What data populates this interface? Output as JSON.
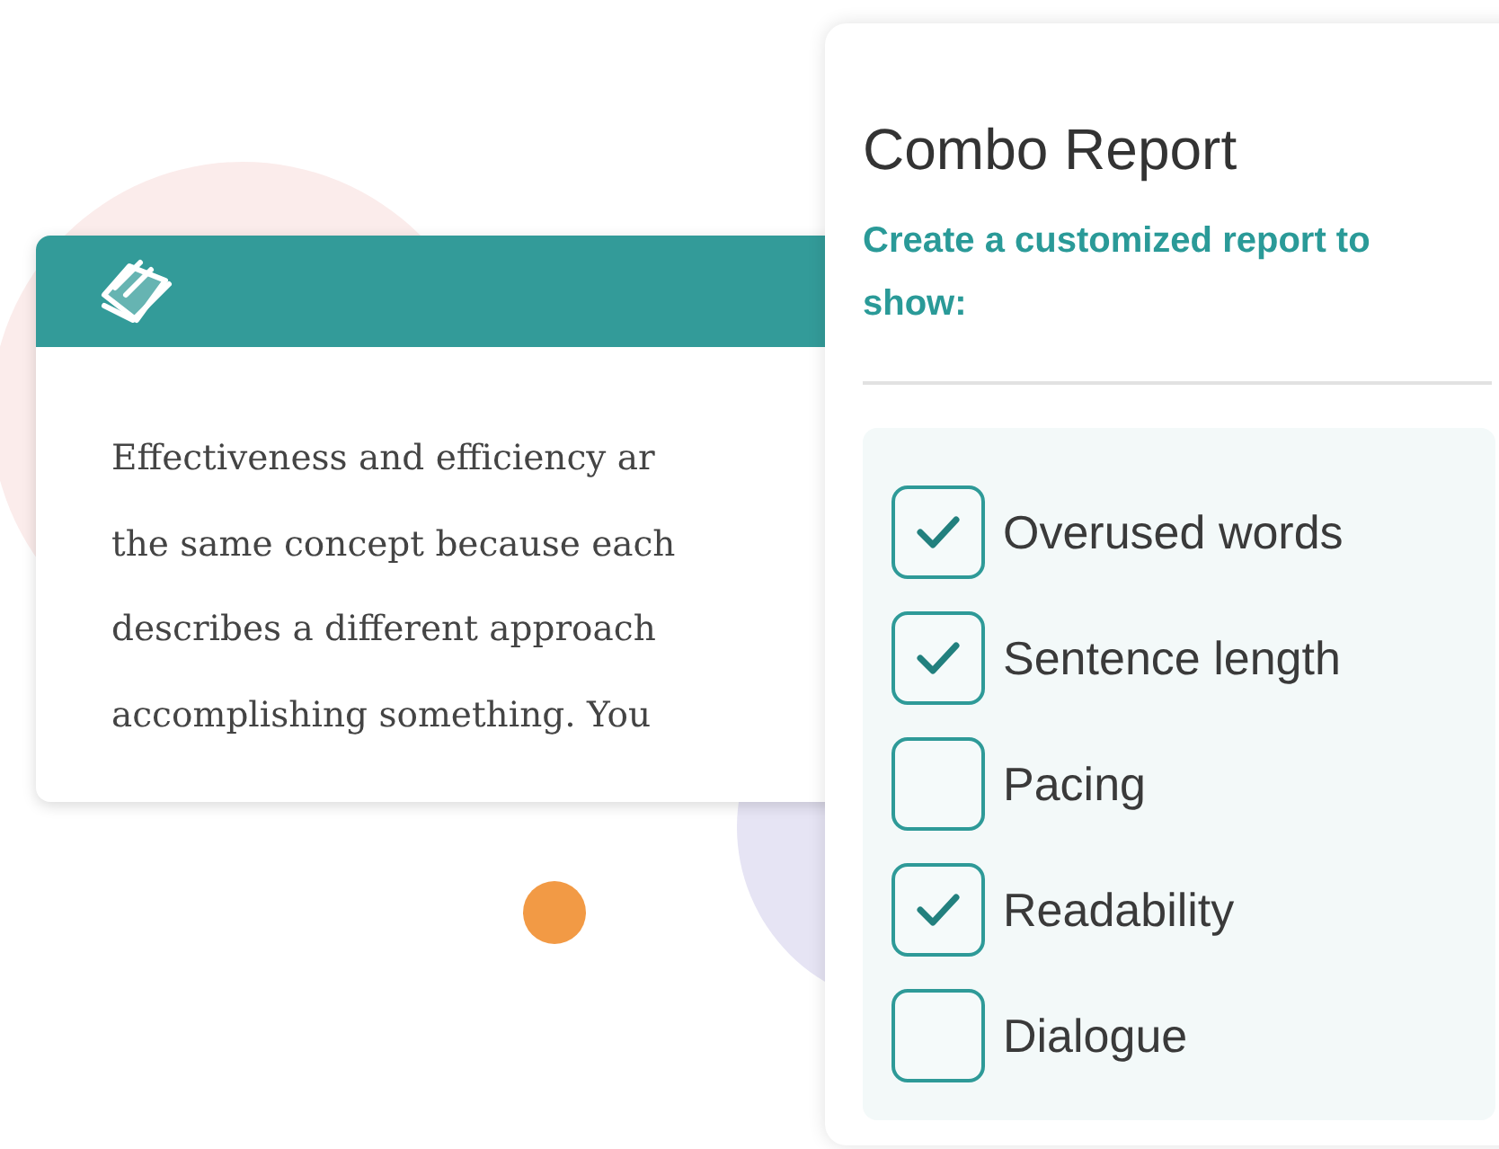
{
  "excerpt_card": {
    "lines": [
      "Effectiveness and efficiency ar",
      "the same concept because each",
      "describes a different approach",
      "accomplishing something. You"
    ]
  },
  "report_panel": {
    "title": "Combo Report",
    "subtitle": "Create a customized report to show:",
    "options": [
      {
        "label": "Overused words",
        "checked": true
      },
      {
        "label": "Sentence length",
        "checked": true
      },
      {
        "label": "Pacing",
        "checked": false
      },
      {
        "label": "Readability",
        "checked": true
      },
      {
        "label": "Dialogue",
        "checked": false
      }
    ]
  }
}
